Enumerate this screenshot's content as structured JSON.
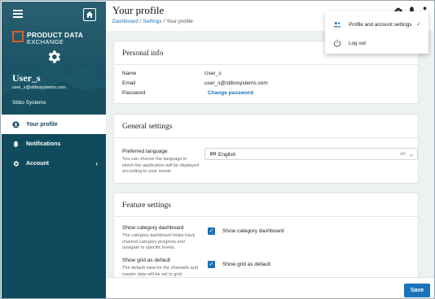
{
  "sidebar": {
    "brand_line1": "PRODUCT DATA",
    "brand_line2": "EXCHANGE",
    "user_name": "User_s",
    "user_email": "user_s@stibosystems.com",
    "organization": "Stibo Systems",
    "items": [
      {
        "label": "Your profile",
        "icon": "person-circle-icon",
        "active": true
      },
      {
        "label": "Notifications",
        "icon": "bell-icon"
      },
      {
        "label": "Account",
        "icon": "gear-icon",
        "has_chevron": true
      }
    ],
    "colors": {
      "background": "#0f4b5c",
      "logo_accent": "#e05a28"
    }
  },
  "header": {
    "title": "Your profile",
    "breadcrumb": [
      "Dashboard",
      "Settings",
      "Your profile"
    ],
    "separator": "/"
  },
  "user_menu": {
    "items": [
      {
        "label": "Profile and account settings",
        "icon": "people-icon",
        "selected": true
      },
      {
        "label": "Log out",
        "icon": "power-icon"
      }
    ]
  },
  "personal_info": {
    "heading": "Personal info",
    "name_label": "Name",
    "name_value": "User_s",
    "email_label": "Email",
    "email_value": "user_s@stibosystems.com",
    "password_label": "Password",
    "password_link": "Change password"
  },
  "general_settings": {
    "heading": "General settings",
    "language_label": "Preferred language",
    "language_help": "You can choose the language in which the application will be displayed according to your needs.",
    "language_flag": "EN",
    "language_value": "English",
    "language_code": "en"
  },
  "feature_settings": {
    "heading": "Feature settings",
    "category_label": "Show category dashboard",
    "category_help": "The category dashboard helps track channel category progress and navigate to specific levels.",
    "category_checkbox": "Show category dashboard",
    "grid_label": "Show grid as default",
    "grid_help": "The default view for the channels and master data will be set to grid.",
    "grid_checkbox": "Show grid as default"
  },
  "footer": {
    "save_label": "Save"
  },
  "accent_color": "#1a73b8"
}
